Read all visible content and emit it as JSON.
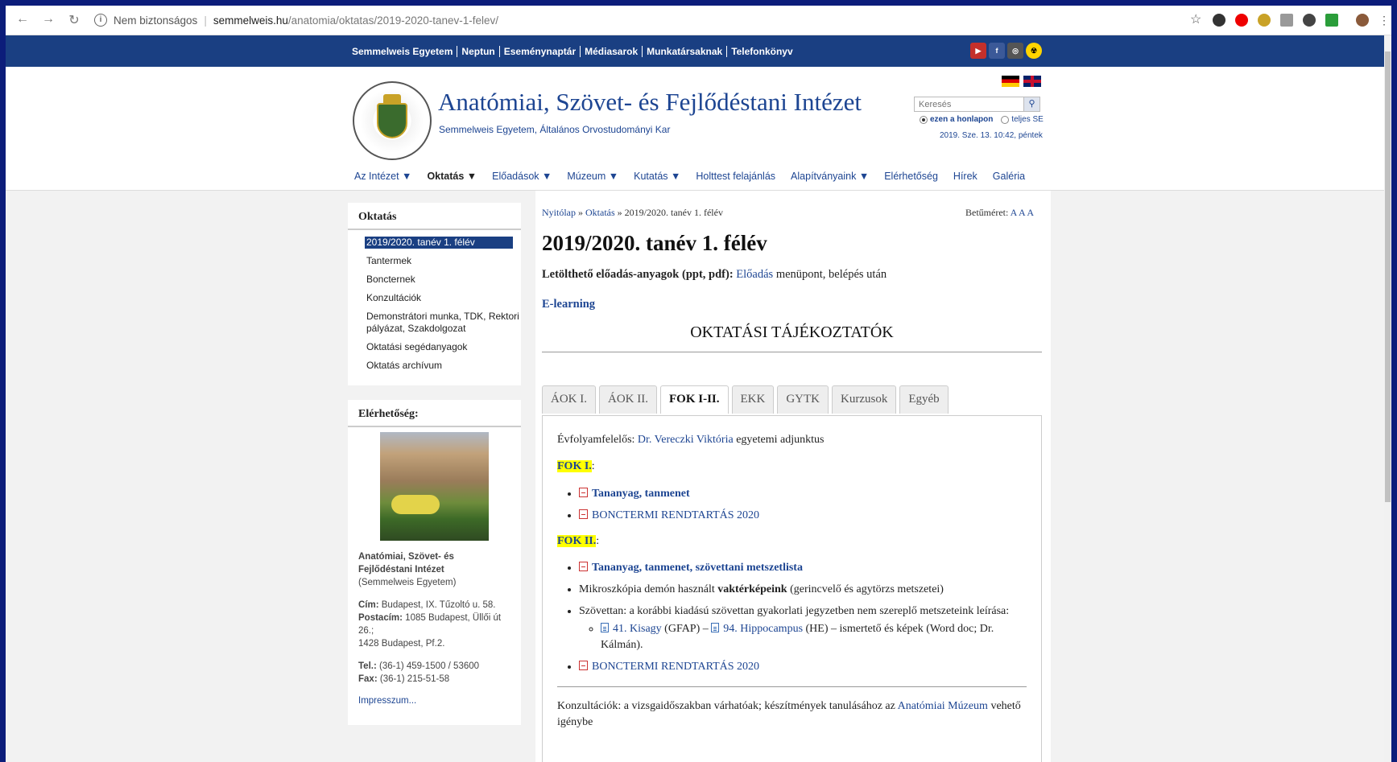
{
  "browser": {
    "security": "Nem biztonságos",
    "domain": "semmelweis.hu",
    "path": "/anatomia/oktatas/2019-2020-tanev-1-felev/"
  },
  "toplinks": [
    "Semmelweis Egyetem",
    "Neptun",
    "Eseménynaptár",
    "Médiasarok",
    "Munkatársaknak",
    "Telefonkönyv"
  ],
  "header": {
    "title": "Anatómiai, Szövet- és Fejlődéstani Intézet",
    "subtitle": "Semmelweis Egyetem, Általános Orvostudományi Kar",
    "search_placeholder": "Keresés",
    "radio_site": "ezen a honlapon",
    "radio_all": "teljes SE",
    "datetime": "2019. Sze. 13. 10:42, péntek"
  },
  "mainnav": [
    {
      "label": "Az Intézet ▼",
      "active": false
    },
    {
      "label": "Oktatás ▼",
      "active": true
    },
    {
      "label": "Előadások ▼",
      "active": false
    },
    {
      "label": "Múzeum ▼",
      "active": false
    },
    {
      "label": "Kutatás ▼",
      "active": false
    },
    {
      "label": "Holttest felajánlás",
      "active": false
    },
    {
      "label": "Alapítványaink ▼",
      "active": false
    },
    {
      "label": "Elérhetőség",
      "active": false
    },
    {
      "label": "Hírek",
      "active": false
    },
    {
      "label": "Galéria",
      "active": false
    }
  ],
  "sidebar": {
    "heading": "Oktatás",
    "items": [
      "2019/2020. tanév 1. félév",
      "Tantermek",
      "Boncternek",
      "Konzultációk",
      "Demonstrátori munka, TDK, Rektori pályázat, Szakdolgozat",
      "Oktatási segédanyagok",
      "Oktatás archívum"
    ],
    "contact_heading": "Elérhetőség:",
    "org_name": "Anatómiai, Szövet- és Fejlődéstani Intézet",
    "org_parent": "(Semmelweis Egyetem)",
    "cim_label": "Cím:",
    "cim": "Budapest, IX. Tűzoltó u. 58.",
    "postacim_label": "Postacím:",
    "postacim": "1085 Budapest, Üllői út 26.;",
    "postacim2": "1428 Budapest, Pf.2.",
    "tel_label": "Tel.:",
    "tel": "(36-1) 459-1500 / 53600",
    "fax_label": "Fax:",
    "fax": "(36-1) 215-51-58",
    "impresszum": "Impresszum..."
  },
  "content": {
    "crumb_home": "Nyitólap",
    "crumb_sep": "»",
    "crumb_oktatas": "Oktatás",
    "crumb_current": "2019/2020. tanév 1. félév",
    "fontsize_label": "Betűméret:",
    "fontsize_options": "A A A",
    "title": "2019/2020. tanév 1. félév",
    "dl_bold": "Letölthető előadás-anyagok (ppt, pdf):",
    "dl_link": "Előadás",
    "dl_rest": "menüpont, belépés után",
    "elearning": "E-learning",
    "section_title": "OKTATÁSI TÁJÉKOZTATÓK",
    "tabs": [
      "ÁOK I.",
      "ÁOK II.",
      "FOK I-II.",
      "EKK",
      "GYTK",
      "Kurzusok",
      "Egyéb"
    ],
    "active_tab": 2,
    "evfolyam_label": "Évfolyamfelelős:",
    "evfolyam_name": "Dr. Vereczki Viktória",
    "evfolyam_rest": "egyetemi adjunktus",
    "fok1": "FOK I.",
    "fok1_colon": ":",
    "fok1_items": [
      "Tananyag, tanmenet",
      "BONCTERMI RENDTARTÁS 2020"
    ],
    "fok2": "FOK II.",
    "fok2_colon": ":",
    "fok2_item1": "Tananyag, tanmenet, szövettani metszetlista",
    "fok2_item2_pre": "Mikroszkópia demón használt",
    "fok2_item2_bold": "vaktérképeink",
    "fok2_item2_post": "(gerincvelő és agytörzs metszetei)",
    "fok2_item3": "Szövettan: a korábbi kiadású szövettan gyakorlati jegyzetben nem szereplő metszeteink leírása:",
    "sub_link1": "41. Kisagy",
    "sub_text1": "(GFAP) –",
    "sub_link2": "94. Hippocampus",
    "sub_text2": "(HE) – ismertető és képek (Word doc; Dr. Kálmán).",
    "fok2_item4": "BONCTERMI RENDTARTÁS 2020",
    "konz_pre": "Konzultációk: a vizsgaidőszakban várhatóak; készítmények tanulásához az",
    "konz_link": "Anatómiai Múzeum",
    "konz_post": "vehető igénybe"
  }
}
